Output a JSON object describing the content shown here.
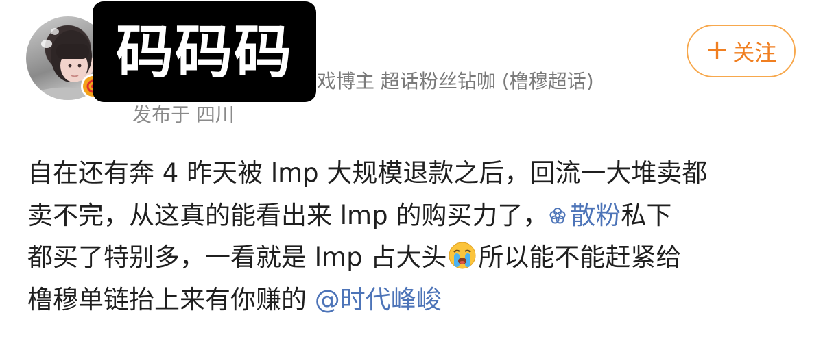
{
  "author": {
    "name": "码码码",
    "meta": "戏博主 超话粉丝钻咖 (橹穆超话)",
    "location": "发布于 四川",
    "avatar_icon": "avatar-photo",
    "badge_icon": "verified-badge-icon"
  },
  "follow_button": {
    "label": "关注",
    "icon": "+",
    "color": "#f07f21"
  },
  "post": {
    "line1": "自在还有奔 4 昨天被 lmp 大规模退款之后，回流一大堆卖都",
    "line2_a": "卖不完，从这真的能看出来 lmp 的购买力了，",
    "topic_link": "散粉",
    "line2_b": "私下",
    "line3_a": "都买了特别多，一看就是 lmp 占大头",
    "line3_b": "所以能不能赶紧给",
    "line4_a": "橹穆单链抬上来有你赚的 ",
    "mention_link": "@时代峰峻",
    "emoji_icon": "crying-face-emoji",
    "link_color": "#4d74b8"
  }
}
